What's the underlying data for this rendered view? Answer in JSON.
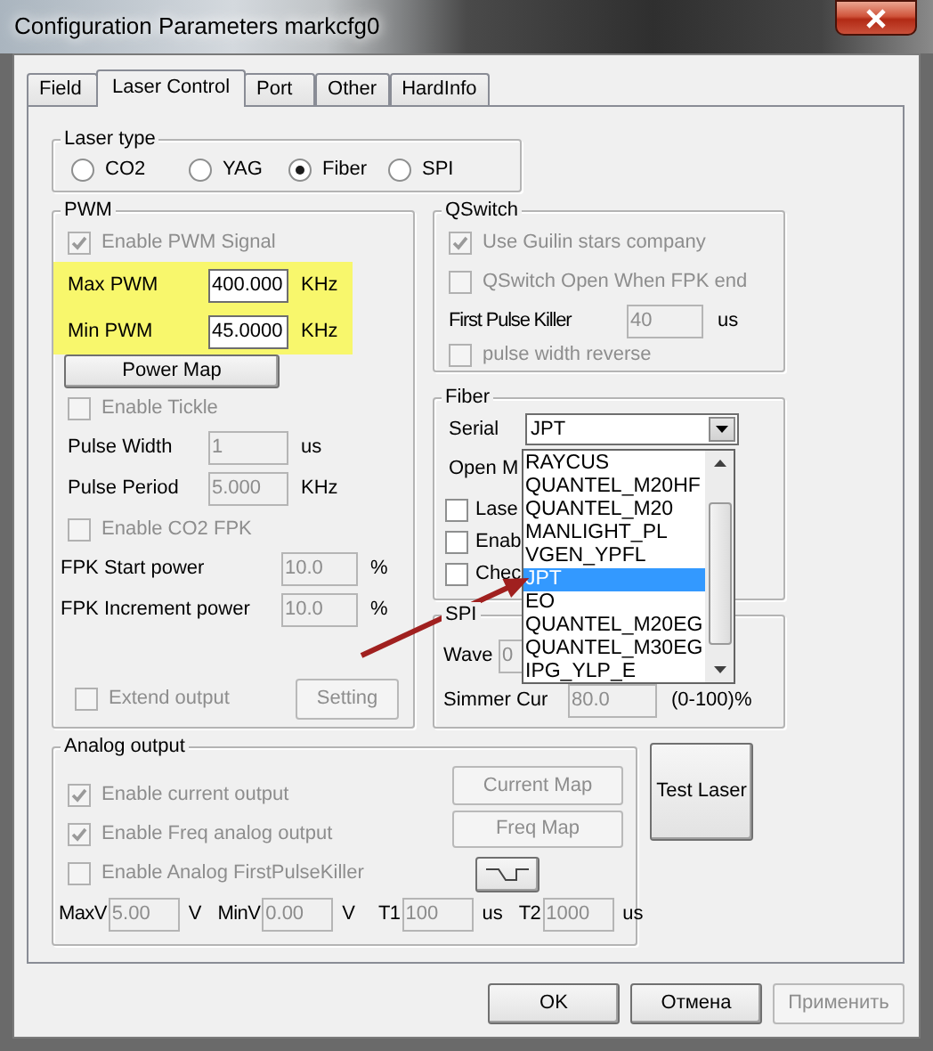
{
  "window": {
    "title": "Configuration Parameters markcfg0"
  },
  "tabs": [
    {
      "label": "Field",
      "selected": false
    },
    {
      "label": "Laser Control",
      "selected": true
    },
    {
      "label": "Port",
      "selected": false
    },
    {
      "label": "Other",
      "selected": false
    },
    {
      "label": "HardInfo",
      "selected": false
    }
  ],
  "laser_type": {
    "label": "Laser type",
    "options": [
      {
        "label": "CO2",
        "selected": false
      },
      {
        "label": "YAG",
        "selected": false
      },
      {
        "label": "Fiber",
        "selected": true
      },
      {
        "label": "SPI",
        "selected": false
      }
    ]
  },
  "pwm": {
    "label": "PWM",
    "items": [
      {
        "kind": "checkbox",
        "label": "Enable PWM Signal",
        "checked": true,
        "disabled": true
      },
      {
        "kind": "field",
        "label": "Max PWM",
        "value": "400.000",
        "unit": "KHz",
        "disabled": false,
        "highlighted": true
      },
      {
        "kind": "field",
        "label": "Min PWM",
        "value": "45.0000",
        "unit": "KHz",
        "disabled": false,
        "highlighted": true
      },
      {
        "kind": "button",
        "label": "Power Map",
        "disabled": false
      },
      {
        "kind": "checkbox",
        "label": "Enable Tickle",
        "checked": false,
        "disabled": true
      },
      {
        "kind": "field",
        "label": "Pulse Width",
        "value": "1",
        "unit": "us",
        "disabled": true,
        "highlighted": false
      },
      {
        "kind": "field",
        "label": "Pulse Period",
        "value": "5.000",
        "unit": "KHz",
        "disabled": true,
        "highlighted": false
      },
      {
        "kind": "checkbox",
        "label": "Enable CO2 FPK",
        "checked": false,
        "disabled": true
      },
      {
        "kind": "field",
        "label": "FPK Start power",
        "value": "10.0",
        "unit": "%",
        "disabled": true,
        "highlighted": false
      },
      {
        "kind": "field",
        "label": "FPK Increment power",
        "value": "10.0",
        "unit": "%",
        "disabled": true,
        "highlighted": false
      },
      {
        "kind": "checkbox_button",
        "label": "Extend output",
        "checked": false,
        "disabled": true,
        "button": {
          "label": "Setting",
          "disabled": true
        }
      }
    ]
  },
  "qswitch": {
    "label": "QSwitch",
    "items": [
      {
        "kind": "checkbox",
        "label": "Use Guilin stars company",
        "checked": true,
        "disabled": true
      },
      {
        "kind": "checkbox",
        "label": "QSwitch Open When FPK end",
        "checked": false,
        "disabled": true
      },
      {
        "kind": "field",
        "label": "First Pulse Killer",
        "value": "40",
        "unit": "us",
        "disabled": true
      },
      {
        "kind": "checkbox",
        "label": "pulse width reverse",
        "checked": false,
        "disabled": true
      }
    ]
  },
  "fiber": {
    "label": "Fiber",
    "serial": {
      "label": "Serial",
      "value": "JPT",
      "expanded": true,
      "options": [
        {
          "label": "RAYCUS",
          "selected": false
        },
        {
          "label": "QUANTEL_M20HF",
          "selected": false
        },
        {
          "label": "QUANTEL_M20",
          "selected": false
        },
        {
          "label": "MANLIGHT_PL",
          "selected": false
        },
        {
          "label": "VGEN_YPFL",
          "selected": false
        },
        {
          "label": "JPT",
          "selected": true
        },
        {
          "label": "EO",
          "selected": false
        },
        {
          "label": "QUANTEL_M20EG",
          "selected": false
        },
        {
          "label": "QUANTEL_M30EG",
          "selected": false
        },
        {
          "label": "IPG_YLP_E",
          "selected": false
        }
      ]
    },
    "row_label": "Open M",
    "checkboxes": [
      {
        "label": "Lase",
        "checked": false
      },
      {
        "label": "Enab",
        "checked": false
      },
      {
        "label": "Chec",
        "checked": false
      }
    ]
  },
  "spi": {
    "label": "SPI",
    "fields": [
      {
        "label": "Wave",
        "value": "0",
        "disabled": true
      },
      {
        "label": "Simmer Cur",
        "value": "80.0",
        "unit": "(0-100)%",
        "disabled": true
      }
    ]
  },
  "analog_output": {
    "label": "Analog output",
    "checkboxes": [
      {
        "label": "Enable current output",
        "checked": true,
        "disabled": true
      },
      {
        "label": "Enable Freq analog output",
        "checked": true,
        "disabled": true
      },
      {
        "label": "Enable Analog FirstPulseKiller",
        "checked": false,
        "disabled": true
      }
    ],
    "buttons": [
      {
        "kind": "text",
        "label": "Current Map",
        "disabled": true
      },
      {
        "kind": "text",
        "label": "Freq Map",
        "disabled": true
      },
      {
        "kind": "pulse",
        "disabled": false
      }
    ],
    "fields": [
      {
        "label": "MaxV",
        "value": "5.00",
        "unit": "V",
        "disabled": true
      },
      {
        "label": "MinV",
        "value": "0.00",
        "unit": "V",
        "disabled": true
      },
      {
        "label": "T1",
        "value": "100",
        "unit": "us",
        "disabled": true
      },
      {
        "label": "T2",
        "value": "1000",
        "unit": "us",
        "disabled": true
      }
    ]
  },
  "test_laser_button": {
    "label": "Test Laser",
    "disabled": false
  },
  "buttons": [
    {
      "label": "OK",
      "disabled": false
    },
    {
      "label": "Отмена",
      "disabled": false
    },
    {
      "label": "Применить",
      "disabled": true
    }
  ]
}
